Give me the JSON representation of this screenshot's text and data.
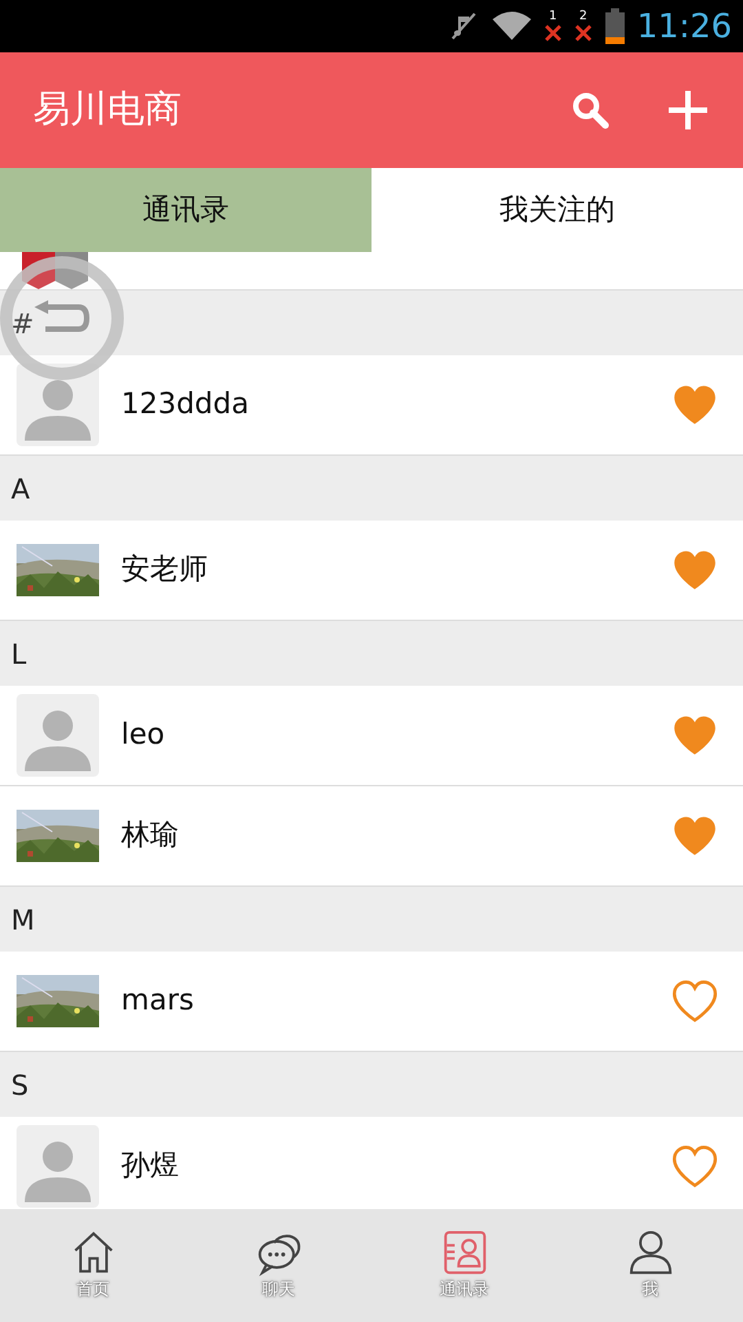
{
  "status_bar": {
    "time": "11:26",
    "sim_slots": [
      "1",
      "2"
    ]
  },
  "app_bar": {
    "title": "易川电商"
  },
  "tabs": [
    {
      "label": "通讯录",
      "selected": true
    },
    {
      "label": "我关注的",
      "selected": false
    }
  ],
  "top_row": {
    "kind": "logo"
  },
  "sections": [
    {
      "header": "#",
      "contacts": [
        {
          "name": "123ddda",
          "kind": "default",
          "followed": true
        }
      ]
    },
    {
      "header": "A",
      "contacts": [
        {
          "name": "安老师",
          "followed": true
        }
      ]
    },
    {
      "header": "L",
      "contacts": [
        {
          "name": "leo",
          "kind": "default",
          "followed": true
        },
        {
          "name": "林瑜",
          "followed": true
        }
      ]
    },
    {
      "header": "M",
      "contacts": [
        {
          "name": "mars",
          "followed": false
        }
      ]
    },
    {
      "header": "S",
      "contacts": [
        {
          "name": "孙煜",
          "kind": "default",
          "followed": false
        }
      ]
    }
  ],
  "bottom_nav": [
    {
      "label": "首页",
      "kind": "home",
      "selected": false
    },
    {
      "label": "聊天",
      "kind": "chat",
      "selected": false
    },
    {
      "label": "通讯录",
      "kind": "contacts",
      "selected": true
    },
    {
      "label": "我",
      "kind": "person",
      "selected": false
    }
  ]
}
